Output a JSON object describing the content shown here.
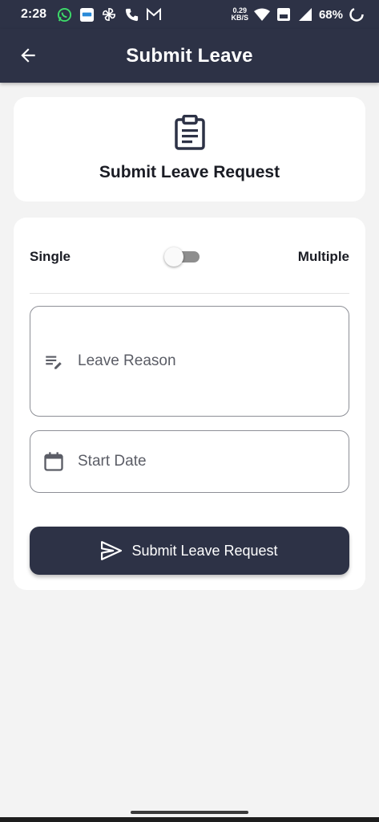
{
  "status_bar": {
    "time": "2:28",
    "speed_value": "0.29",
    "speed_unit": "KB/S",
    "battery": "68%",
    "icons": [
      "whatsapp-icon",
      "app-notification-icon",
      "pinwheel-icon",
      "call-icon",
      "gmail-icon",
      "wifi-icon",
      "volte-icon",
      "signal-icon",
      "battery-icon"
    ]
  },
  "app_bar": {
    "title": "Submit Leave",
    "back_icon": "arrow-back-icon"
  },
  "header_card": {
    "icon": "clipboard-icon",
    "title": "Submit Leave Request"
  },
  "form": {
    "toggle": {
      "left_label": "Single",
      "right_label": "Multiple",
      "state": "off"
    },
    "reason_field": {
      "placeholder": "Leave Reason",
      "value": "",
      "icon": "edit-notes-icon"
    },
    "start_date_field": {
      "placeholder": "Start Date",
      "value": "",
      "icon": "calendar-icon"
    },
    "submit_button": {
      "label": "Submit Leave Request",
      "icon": "send-icon"
    }
  },
  "colors": {
    "primary": "#2d3246",
    "background": "#f3f3f3",
    "card": "#ffffff",
    "field_border": "#8d8f96"
  }
}
